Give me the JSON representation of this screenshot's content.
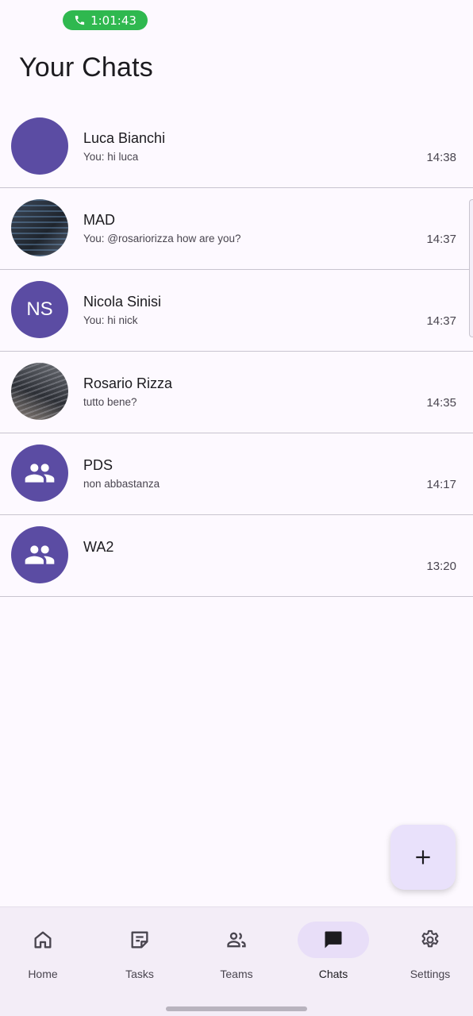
{
  "status_bar": {
    "call_timer": "1:01:43",
    "call_color": "#2fb84f"
  },
  "header": {
    "title": "Your Chats"
  },
  "chats": [
    {
      "name": "Luca Bianchi",
      "preview": "You: hi luca",
      "time": "14:38",
      "avatar": "solid"
    },
    {
      "name": "MAD",
      "preview": "You: @rosariorizza how are you?",
      "time": "14:37",
      "avatar": "photo-code"
    },
    {
      "name": "Nicola Sinisi",
      "preview": "You: hi nick",
      "time": "14:37",
      "avatar": "initials",
      "initials": "NS"
    },
    {
      "name": "Rosario Rizza",
      "preview": "tutto bene?",
      "time": "14:35",
      "avatar": "photo-desk"
    },
    {
      "name": "PDS",
      "preview": "non abbastanza",
      "time": "14:17",
      "avatar": "group-icon"
    },
    {
      "name": "WA2",
      "preview": "",
      "time": "13:20",
      "avatar": "group-icon"
    }
  ],
  "fab": {
    "icon": "plus-icon"
  },
  "nav": {
    "items": [
      {
        "label": "Home",
        "icon": "home-icon"
      },
      {
        "label": "Tasks",
        "icon": "tasks-icon"
      },
      {
        "label": "Teams",
        "icon": "teams-icon"
      },
      {
        "label": "Chats",
        "icon": "chat-icon",
        "active": true
      },
      {
        "label": "Settings",
        "icon": "gear-icon"
      }
    ]
  },
  "colors": {
    "accent": "#5b4ca3",
    "nav_active_pill": "#e8def8",
    "fab_bg": "#e9e1fb",
    "background": "#fdf9ff"
  }
}
